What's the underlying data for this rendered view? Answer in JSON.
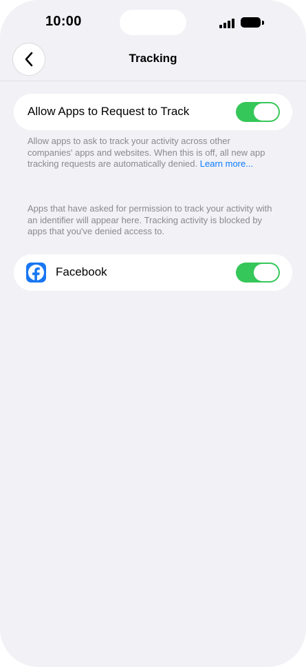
{
  "status_bar": {
    "time": "10:00"
  },
  "nav": {
    "title": "Tracking",
    "back_icon": "chevron-left-icon"
  },
  "allow_tracking": {
    "label": "Allow Apps to Request to Track",
    "enabled": true,
    "footer_text": "Allow apps to ask to track your activity across other companies' apps and websites. When this is off, all new app tracking requests are automatically denied. ",
    "footer_link": "Learn more..."
  },
  "apps_section": {
    "footer_text": "Apps that have asked for permission to track your activity with an identifier will appear here. Tracking activity is blocked by apps that you've denied access to.",
    "apps": [
      {
        "name": "Facebook",
        "icon": "facebook-icon",
        "enabled": true
      }
    ]
  },
  "colors": {
    "background": "#f1f1f6",
    "toggle_on": "#35c759",
    "link": "#0a7aff",
    "facebook_blue": "#1877f2",
    "secondary_text": "#8a8a8e"
  }
}
